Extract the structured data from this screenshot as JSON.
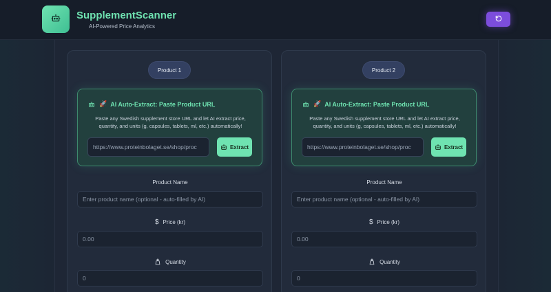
{
  "header": {
    "app_title": "SupplementScanner",
    "app_subtitle": "AI-Powered Price Analytics",
    "logo_icon": "robot-icon",
    "refresh_icon": "refresh-icon"
  },
  "products": [
    {
      "pill_label": "Product 1",
      "extract": {
        "title": "AI Auto-Extract: Paste Product URL",
        "description": "Paste any Swedish supplement store URL and let AI extract price, quantity, and units (g, capsules, tablets, ml, etc.) automatically!",
        "url_value": "https://www.proteinbolaget.se/shop/proc",
        "button_label": "Extract"
      },
      "fields": {
        "name_label": "Product Name",
        "name_placeholder": "Enter product name (optional - auto-filled by AI)",
        "price_label": "Price (kr)",
        "price_placeholder": "0.00",
        "quantity_label": "Quantity",
        "quantity_placeholder": "0"
      }
    },
    {
      "pill_label": "Product 2",
      "extract": {
        "title": "AI Auto-Extract: Paste Product URL",
        "description": "Paste any Swedish supplement store URL and let AI extract price, quantity, and units (g, capsules, tablets, ml, etc.) automatically!",
        "url_value": "https://www.proteinbolaget.se/shop/proc",
        "button_label": "Extract"
      },
      "fields": {
        "name_label": "Product Name",
        "name_placeholder": "Enter product name (optional - auto-filled by AI)",
        "price_label": "Price (kr)",
        "price_placeholder": "0.00",
        "quantity_label": "Quantity",
        "quantity_placeholder": "0"
      }
    }
  ],
  "colors": {
    "accent_green": "#6fe3b1",
    "accent_purple": "#7c4ddc",
    "background": "#1a2230"
  }
}
